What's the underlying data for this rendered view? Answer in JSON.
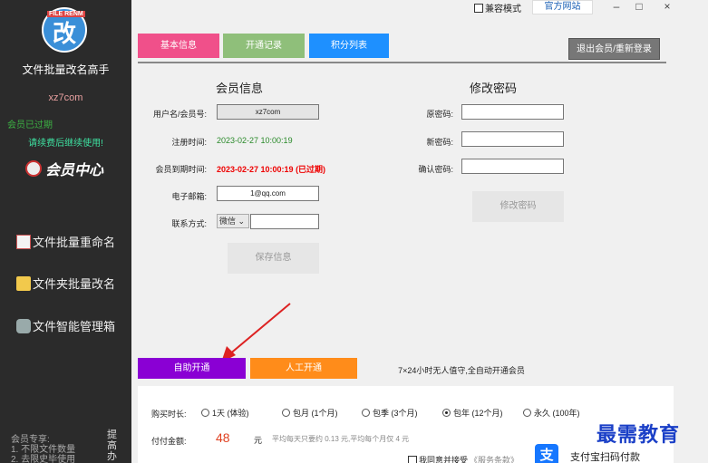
{
  "sidebar": {
    "logo_badge": "FILE RENM",
    "logo_char": "改",
    "app_name": "文件批量改名高手",
    "site": "xz7com",
    "status_expired": "会员已过期",
    "renew_msg": "请续费后继续使用!",
    "member_center": "会员中心",
    "nav": [
      {
        "label": "文件批量重命名",
        "icon": "document-icon"
      },
      {
        "label": "文件夹批量改名",
        "icon": "folder-icon"
      },
      {
        "label": "文件智能管理箱",
        "icon": "gamepad-icon"
      }
    ],
    "member_priv": [
      "会员专享:",
      "1. 不限文件数量",
      "2. 去限史毕使用"
    ],
    "side_vert": "提高办"
  },
  "topbar": {
    "compat_label": "兼容模式",
    "official_label": "官方网站",
    "minimize": "–",
    "maximize": "□",
    "close": "×"
  },
  "tabs": [
    {
      "label": "基本信息",
      "color": "#f0508a"
    },
    {
      "label": "开通记录",
      "color": "#8fbf7a"
    },
    {
      "label": "积分列表",
      "color": "#1e90ff"
    }
  ],
  "logout_label": "退出会员/重新登录",
  "member_info": {
    "title": "会员信息",
    "username_label": "用户名/会员号:",
    "username_value": "xz7com",
    "register_label": "注册时间:",
    "register_value": "2023-02-27 10:00:19",
    "expire_label": "会员到期时间:",
    "expire_value": "2023-02-27 10:00:19 (已过期)",
    "email_label": "电子邮箱:",
    "email_value": "1@qq.com",
    "contact_label": "联系方式:",
    "contact_select": "微信",
    "contact_value": "",
    "save_label": "保存信息"
  },
  "password": {
    "title": "修改密码",
    "old_label": "原密码:",
    "new_label": "新密码:",
    "confirm_label": "确认密码:",
    "submit_label": "修改密码"
  },
  "purchase": {
    "tab_auto": "自助开通",
    "tab_auto_color": "#8a00d4",
    "tab_manual": "人工开通",
    "tab_manual_color": "#ff8c1a",
    "tab_note": "7×24小时无人值守,全自动开通会员",
    "duration_label": "购买时长:",
    "options": [
      {
        "label": "1天 (体验)",
        "selected": false
      },
      {
        "label": "包月 (1个月)",
        "selected": false
      },
      {
        "label": "包季 (3个月)",
        "selected": false
      },
      {
        "label": "包年 (12个月)",
        "selected": true
      },
      {
        "label": "永久 (100年)",
        "selected": false
      }
    ],
    "amount_label": "付金额:",
    "amount_prefix": "付",
    "price": "48",
    "unit": "元",
    "avg_text": "平均每天只要约 0.13 元,平均每个月仅 4 元",
    "agree_text": "我同意并接受",
    "agree_link": "《服务条款》",
    "alipay_icon": "支",
    "alipay_label": "支付宝扫码付款"
  },
  "watermark": "最需教育"
}
